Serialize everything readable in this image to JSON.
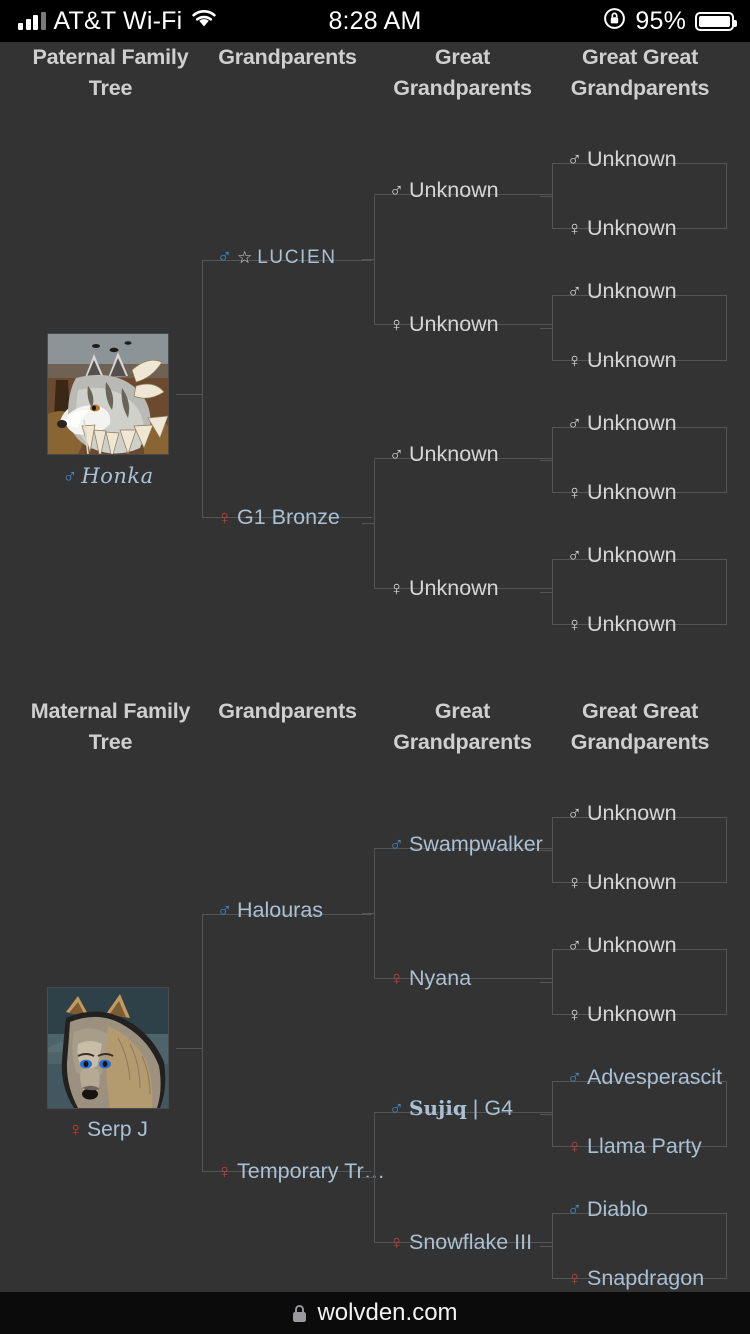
{
  "status_bar": {
    "carrier": "AT&T Wi-Fi",
    "wifi_icon": "wifi-icon",
    "signal_icon": "cellular-bars-icon",
    "time": "8:28 AM",
    "rotation_lock_icon": "rotation-lock-icon",
    "battery_percent": "95%",
    "battery_icon": "battery-icon"
  },
  "browser": {
    "lock_icon": "lock-icon",
    "url": "wolvden.com"
  },
  "colors": {
    "page_bg": "#333333",
    "border": "#555555",
    "male": "#3f8fcc",
    "female": "#cc3d33",
    "name_text": "#aac0d4",
    "unknown_text": "#d6d6d6",
    "heading": "#cfcfcf"
  },
  "paternal": {
    "columns": [
      "Paternal Family Tree",
      "Grandparents",
      "Great Grandparents",
      "Great Great Grandparents"
    ],
    "subject": {
      "name": "Honka",
      "sex_symbol": "♂",
      "sex": "male",
      "portrait_alt": "grey wolf with feathers in forest"
    },
    "grandparents": [
      {
        "sex_symbol": "♂",
        "sex": "male",
        "star": "☆",
        "name": "LUCIEN",
        "known": true
      },
      {
        "sex_symbol": "♀",
        "sex": "female",
        "name": "G1 Bronze",
        "known": true
      }
    ],
    "great_grandparents": [
      {
        "sex_symbol": "♂",
        "sex": "male",
        "name": "Unknown",
        "known": false
      },
      {
        "sex_symbol": "♀",
        "sex": "female",
        "name": "Unknown",
        "known": false
      },
      {
        "sex_symbol": "♂",
        "sex": "male",
        "name": "Unknown",
        "known": false
      },
      {
        "sex_symbol": "♀",
        "sex": "female",
        "name": "Unknown",
        "known": false
      }
    ],
    "great_great_grandparents": [
      {
        "sex_symbol": "♂",
        "sex": "male",
        "name": "Unknown",
        "known": false
      },
      {
        "sex_symbol": "♀",
        "sex": "female",
        "name": "Unknown",
        "known": false
      },
      {
        "sex_symbol": "♂",
        "sex": "male",
        "name": "Unknown",
        "known": false
      },
      {
        "sex_symbol": "♀",
        "sex": "female",
        "name": "Unknown",
        "known": false
      },
      {
        "sex_symbol": "♂",
        "sex": "male",
        "name": "Unknown",
        "known": false
      },
      {
        "sex_symbol": "♀",
        "sex": "female",
        "name": "Unknown",
        "known": false
      },
      {
        "sex_symbol": "♂",
        "sex": "male",
        "name": "Unknown",
        "known": false
      },
      {
        "sex_symbol": "♀",
        "sex": "female",
        "name": "Unknown",
        "known": false
      }
    ]
  },
  "maternal": {
    "columns": [
      "Maternal Family Tree",
      "Grandparents",
      "Great Grandparents",
      "Great Great Grandparents"
    ],
    "subject": {
      "name": "Serp J",
      "sex_symbol": "♀",
      "sex": "female",
      "portrait_alt": "tan grey wolf with blue eyes on teal background"
    },
    "grandparents": [
      {
        "sex_symbol": "♂",
        "sex": "male",
        "name": "Halouras",
        "known": true
      },
      {
        "sex_symbol": "♀",
        "sex": "female",
        "name": "Temporary Tr…",
        "known": true
      }
    ],
    "great_grandparents": [
      {
        "sex_symbol": "♂",
        "sex": "male",
        "name": "Swampwalker",
        "known": true
      },
      {
        "sex_symbol": "♀",
        "sex": "female",
        "name": "Nyana",
        "known": true
      },
      {
        "sex_symbol": "♂",
        "sex": "male",
        "name": "Sujiq",
        "suffix": "| G4",
        "known": true
      },
      {
        "sex_symbol": "♀",
        "sex": "female",
        "name": "Snowflake III",
        "known": true
      }
    ],
    "great_great_grandparents": [
      {
        "sex_symbol": "♂",
        "sex": "male",
        "name": "Unknown",
        "known": false
      },
      {
        "sex_symbol": "♀",
        "sex": "female",
        "name": "Unknown",
        "known": false
      },
      {
        "sex_symbol": "♂",
        "sex": "male",
        "name": "Unknown",
        "known": false
      },
      {
        "sex_symbol": "♀",
        "sex": "female",
        "name": "Unknown",
        "known": false
      },
      {
        "sex_symbol": "♂",
        "sex": "male",
        "name": "Advesperascit",
        "known": true
      },
      {
        "sex_symbol": "♀",
        "sex": "female",
        "name": "Llama Party",
        "known": true
      },
      {
        "sex_symbol": "♂",
        "sex": "male",
        "name": "Diablo",
        "known": true
      },
      {
        "sex_symbol": "♀",
        "sex": "female",
        "name": "Snapdragon",
        "known": true
      }
    ]
  }
}
